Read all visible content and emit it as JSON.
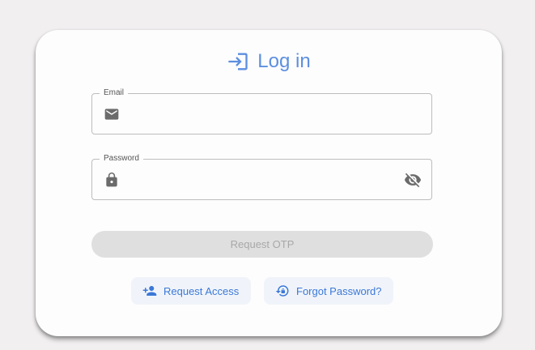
{
  "header": {
    "title": "Log in",
    "icon": "login-icon",
    "accent_color": "#5d8fdf"
  },
  "form": {
    "email": {
      "label": "Email",
      "value": "",
      "icon": "email-icon"
    },
    "password": {
      "label": "Password",
      "value": "",
      "icon": "lock-icon",
      "toggle_icon": "visibility-off-icon"
    },
    "submit_label": "Request OTP"
  },
  "links": {
    "request_access": {
      "label": "Request Access",
      "icon": "person-add-icon"
    },
    "forgot_password": {
      "label": "Forgot Password?",
      "icon": "lock-reset-icon"
    },
    "color": "#3b78d8"
  }
}
